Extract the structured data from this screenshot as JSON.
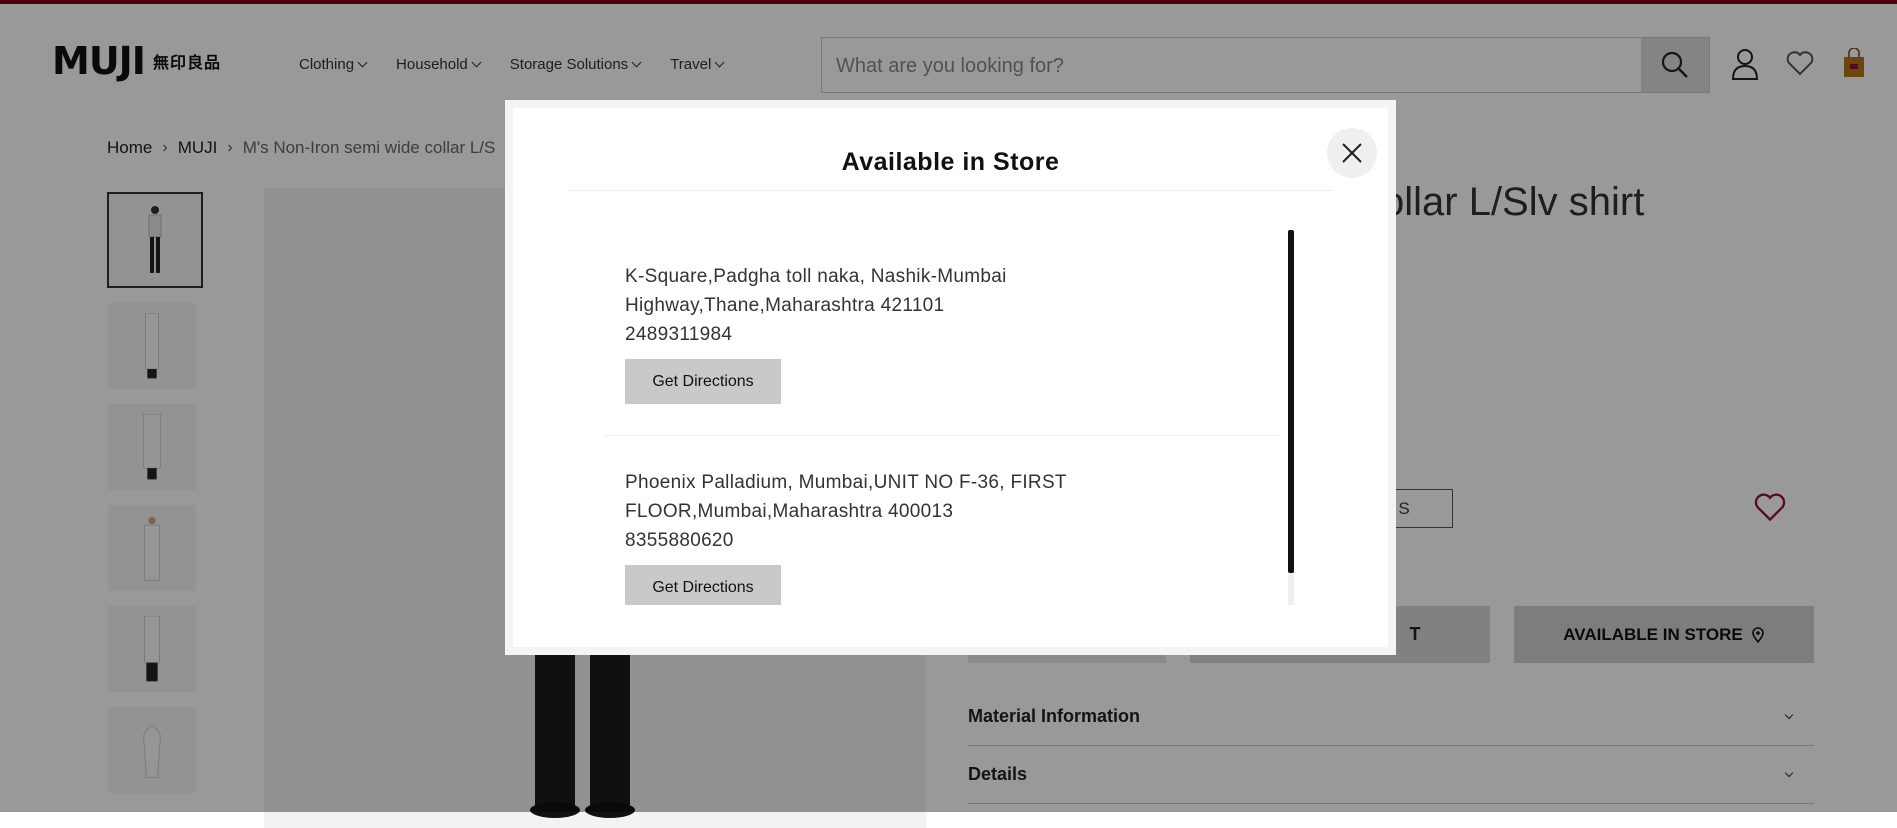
{
  "header": {
    "logo_text": "MUJI",
    "logo_kanji": "無印良品",
    "nav": [
      {
        "label": "Clothing"
      },
      {
        "label": "Household"
      },
      {
        "label": "Storage Solutions"
      },
      {
        "label": "Travel"
      }
    ],
    "search_placeholder": "What are you looking for?",
    "icons": [
      "search-icon",
      "account-icon",
      "wishlist-icon",
      "bag-icon"
    ]
  },
  "breadcrumb": {
    "items": [
      "Home",
      "MUJI",
      "M's Non-Iron semi wide collar L/S"
    ],
    "separator": "›"
  },
  "product": {
    "title_partial": "ollar L/Slv shirt",
    "size": "S",
    "add_to_cart_partial": "T",
    "available_in_store": "AVAILABLE IN STORE",
    "accordions": [
      "Material Information",
      "Details"
    ]
  },
  "modal": {
    "title": "Available in Store",
    "stores": [
      {
        "address_line1": "K-Square,Padgha toll naka, Nashik-Mumbai",
        "address_line2": "Highway,Thane,Maharashtra 421101",
        "phone": "2489311984",
        "button": "Get Directions"
      },
      {
        "address_line1": "Phoenix Palladium, Mumbai,UNIT NO F-36, FIRST",
        "address_line2": "FLOOR,Mumbai,Maharashtra 400013",
        "phone": "8355880620",
        "button": "Get Directions"
      }
    ]
  },
  "colors": {
    "brand_bar": "#7f0019",
    "bag_icon": "#b5761f",
    "wishlist_icon": "#8a1230"
  }
}
